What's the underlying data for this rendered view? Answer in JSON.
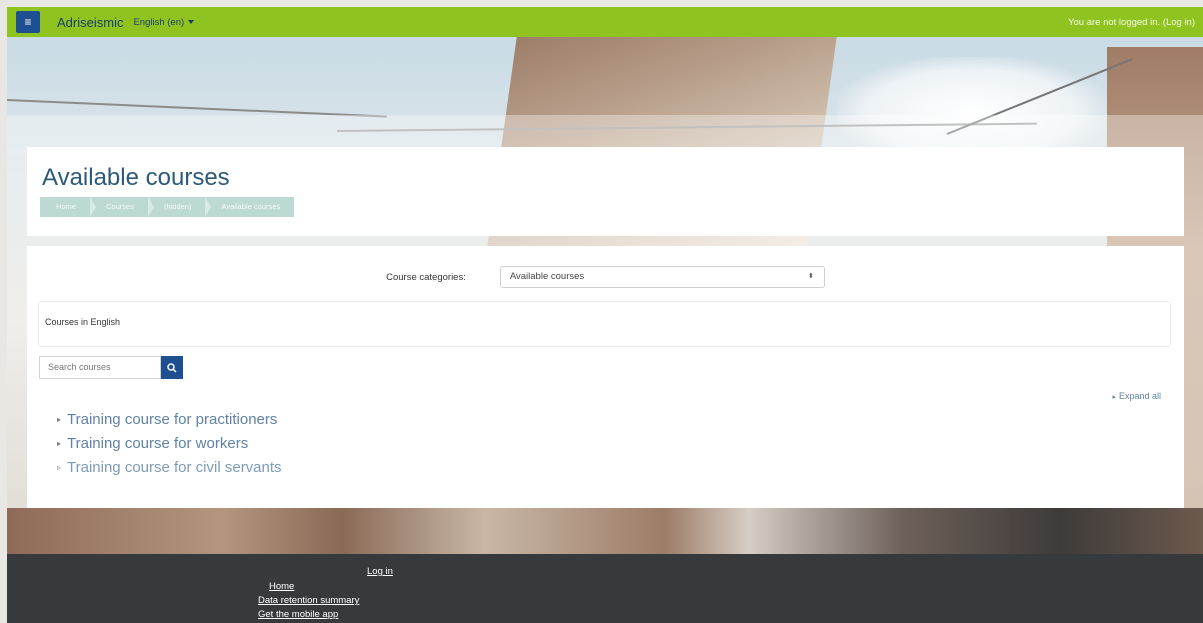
{
  "navbar": {
    "menu_icon": "hamburger-icon",
    "brand": "Adriseismic",
    "language": "English (en)",
    "login_text": "You are not logged in.",
    "login_link": "(Log in)",
    "colors": {
      "bar": "#8fc31f",
      "button": "#1d4f91"
    }
  },
  "header": {
    "title": "Available courses",
    "breadcrumb": [
      "Home",
      "Courses",
      "(hidden)",
      "Available courses"
    ]
  },
  "main": {
    "category_label": "Course categories:",
    "category_selected": "Available courses",
    "category_box_text": "Courses in English",
    "search_placeholder": "Search courses",
    "search_icon": "search-icon",
    "expand_all": "Expand all",
    "courses": [
      "Training course for practitioners",
      "Training course for workers",
      "Training course for civil servants"
    ]
  },
  "footer": {
    "login": "Log in",
    "home": "Home",
    "data_retention": "Data retention summary",
    "mobile_app": "Get the mobile app"
  }
}
